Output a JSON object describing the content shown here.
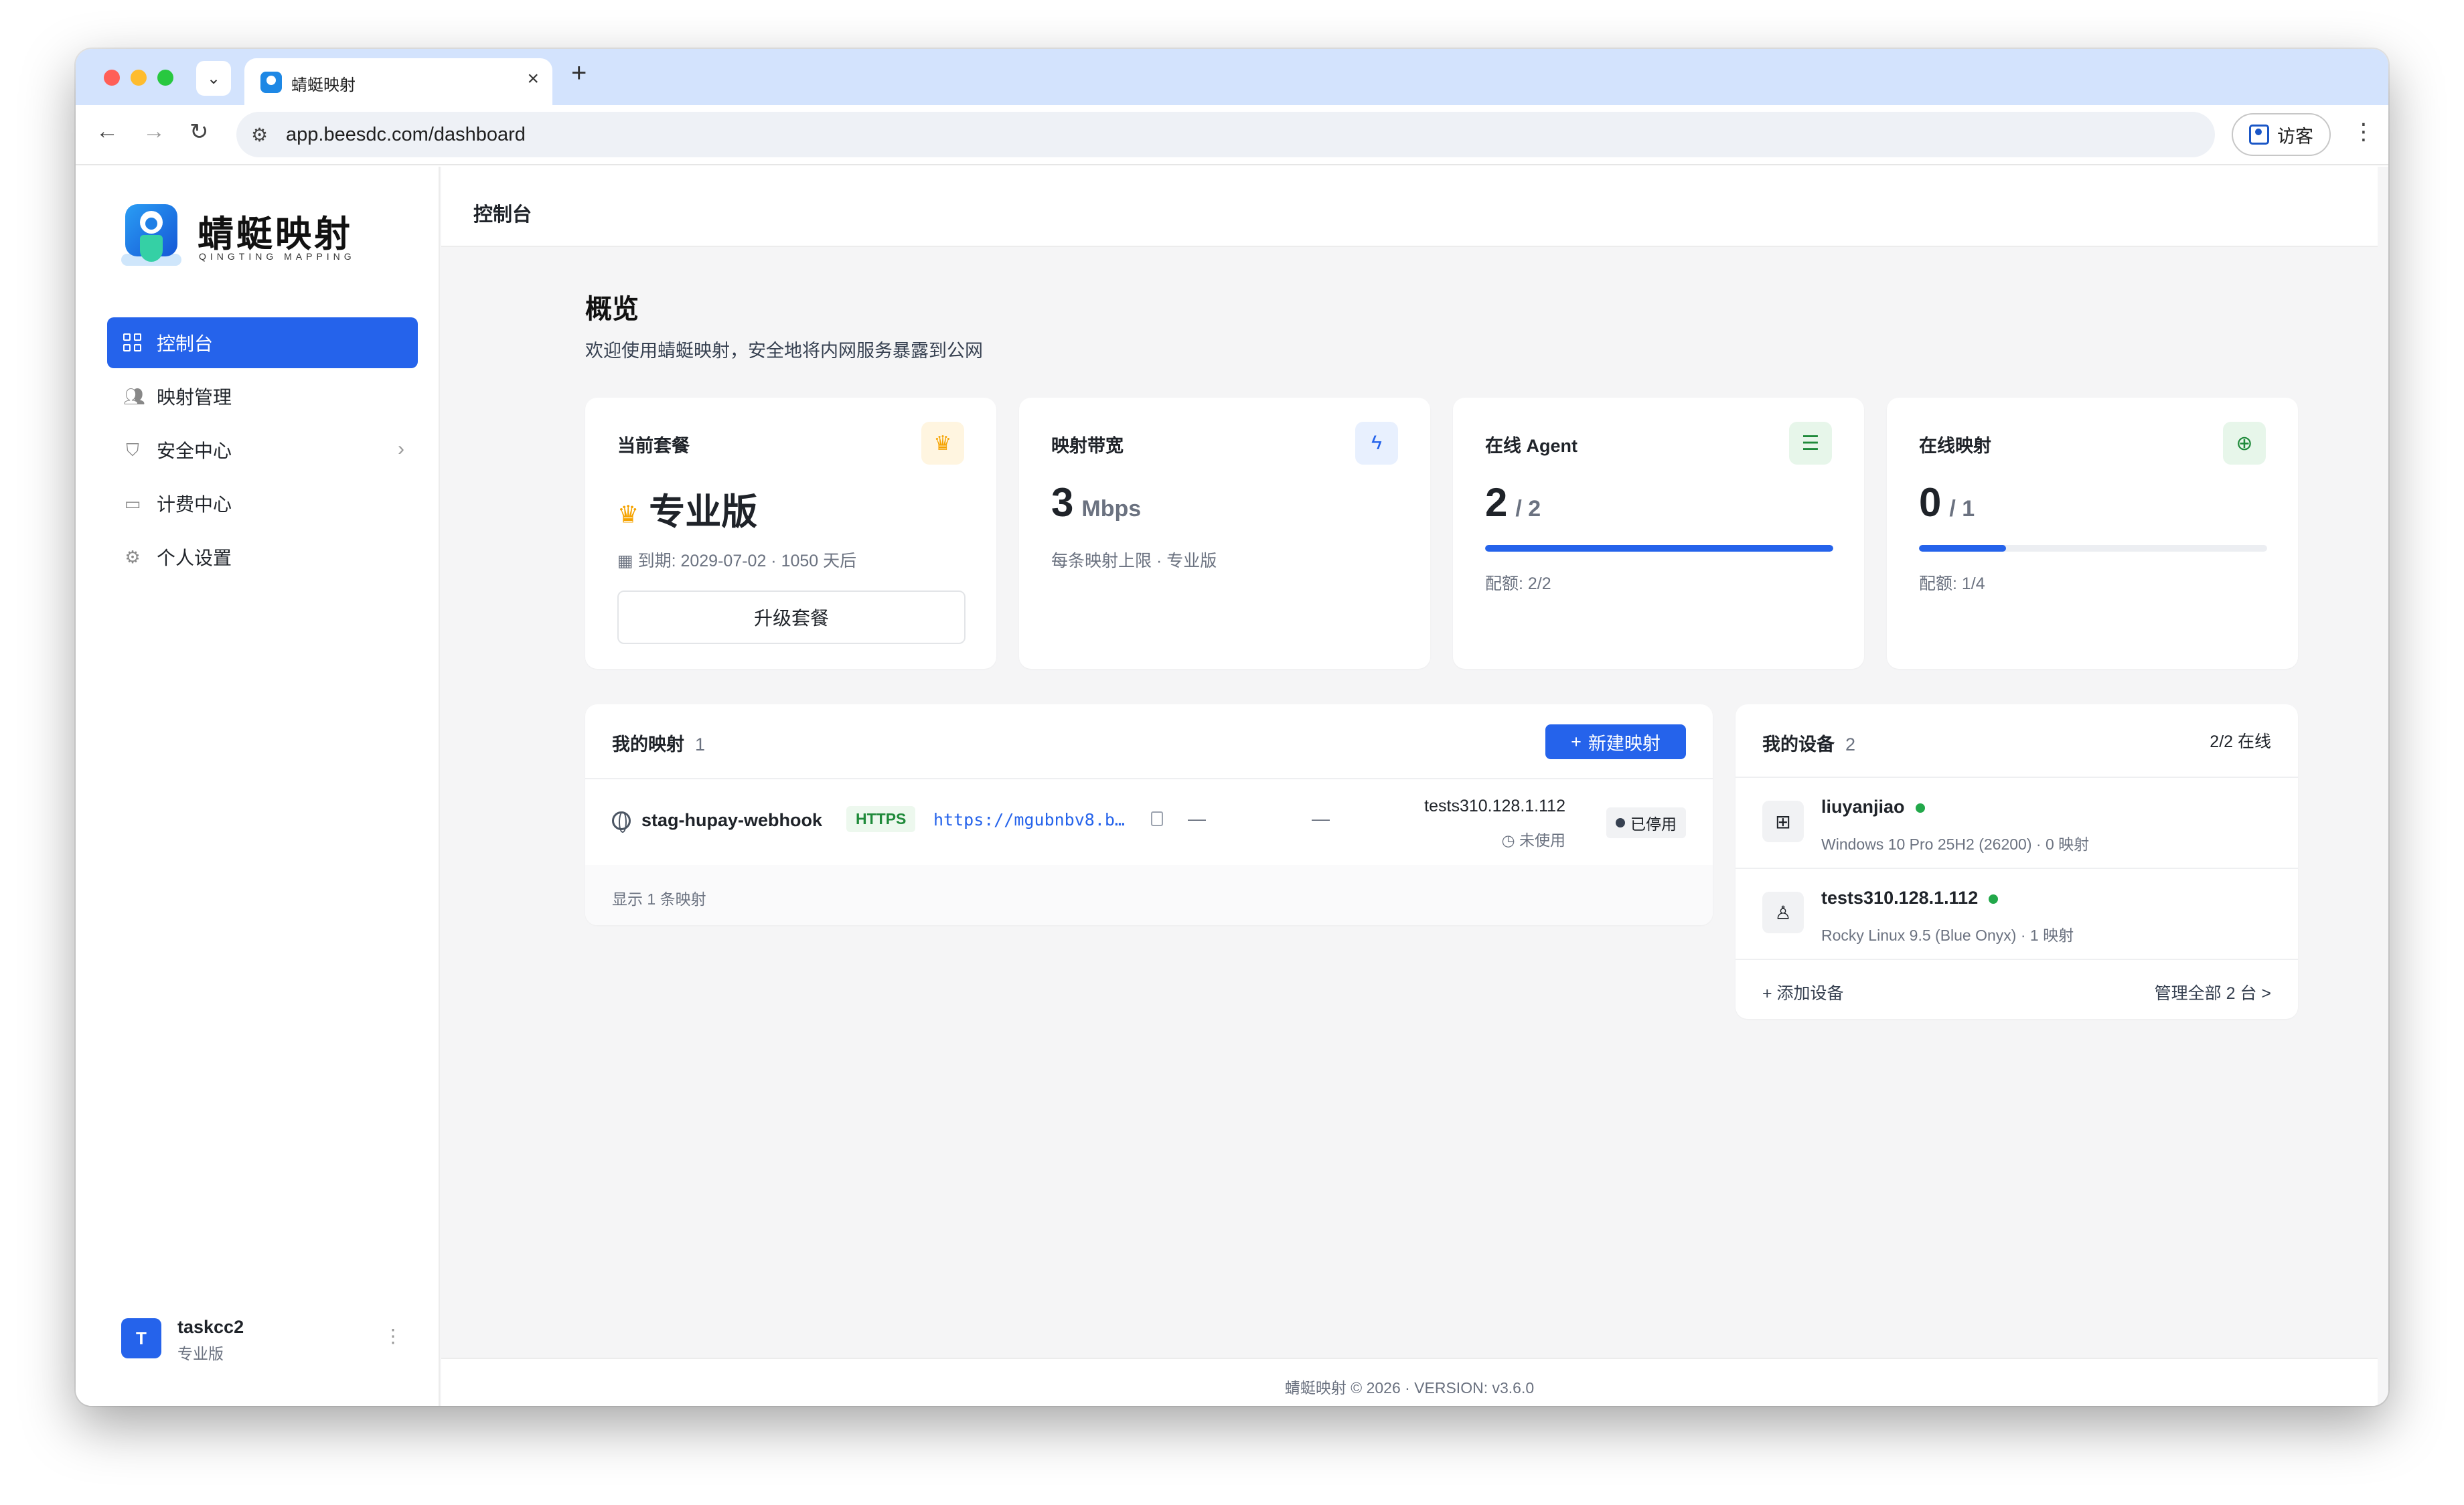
{
  "browser": {
    "tab_title": "蜻蜓映射",
    "url_host": "app.beesdc.com",
    "url_path": "/dashboard",
    "profile_label": "访客"
  },
  "sidebar": {
    "logo_title": "蜻蜓映射",
    "logo_subtitle": "QINGTING MAPPING",
    "items": [
      {
        "label": "控制台",
        "icon": "dashboard-grid-icon",
        "active": true
      },
      {
        "label": "映射管理",
        "icon": "users-icon"
      },
      {
        "label": "安全中心",
        "icon": "shield-icon",
        "has_chevron": true
      },
      {
        "label": "计费中心",
        "icon": "card-icon"
      },
      {
        "label": "个人设置",
        "icon": "gear-icon"
      }
    ],
    "user": {
      "initial": "T",
      "name": "taskcc2",
      "plan": "专业版"
    }
  },
  "topbar": {
    "title": "控制台"
  },
  "overview": {
    "title": "概览",
    "subtitle": "欢迎使用蜻蜓映射，安全地将内网服务暴露到公网"
  },
  "stats": {
    "plan": {
      "label": "当前套餐",
      "value": "专业版",
      "expiry": "到期: 2029-07-02 · 1050 天后",
      "button": "升级套餐"
    },
    "bandwidth": {
      "label": "映射带宽",
      "value": "3",
      "unit": "Mbps",
      "note": "每条映射上限 · 专业版"
    },
    "agents": {
      "label": "在线 Agent",
      "value": "2",
      "total": "/ 2",
      "note": "配额: 2/2",
      "fill": 1.0
    },
    "mappings": {
      "label": "在线映射",
      "value": "0",
      "total": "/ 1",
      "note": "配额: 1/4",
      "fill": 0.25
    }
  },
  "my_mappings": {
    "title": "我的映射",
    "count": "1",
    "new_button": "新建映射",
    "rows": [
      {
        "name": "stag-hupay-webhook",
        "protocol": "HTTPS",
        "url": "https://mgubnbv8.b…",
        "col1": "—",
        "col2": "—",
        "host": "tests310.128.1.112",
        "usage": "未使用",
        "status": "已停用"
      }
    ],
    "footer": "显示 1 条映射"
  },
  "my_devices": {
    "title": "我的设备",
    "count": "2",
    "online": "2/2 在线",
    "rows": [
      {
        "name": "liuyanjiao",
        "meta": "Windows 10 Pro 25H2 (26200) · 0 映射",
        "os_icon": "windows-icon"
      },
      {
        "name": "tests310.128.1.112",
        "meta": "Rocky Linux 9.5 (Blue Onyx) · 1 映射",
        "os_icon": "linux-icon"
      }
    ],
    "add_label": "+ 添加设备",
    "manage_label": "管理全部 2 台 >"
  },
  "footer": {
    "text": "蜻蜓映射 © 2026 · VERSION: v3.6.0"
  },
  "colors": {
    "accent": "#2563eb",
    "online": "#22a84a",
    "crown": "#f5a300",
    "https_green": "#1f8a3a"
  }
}
